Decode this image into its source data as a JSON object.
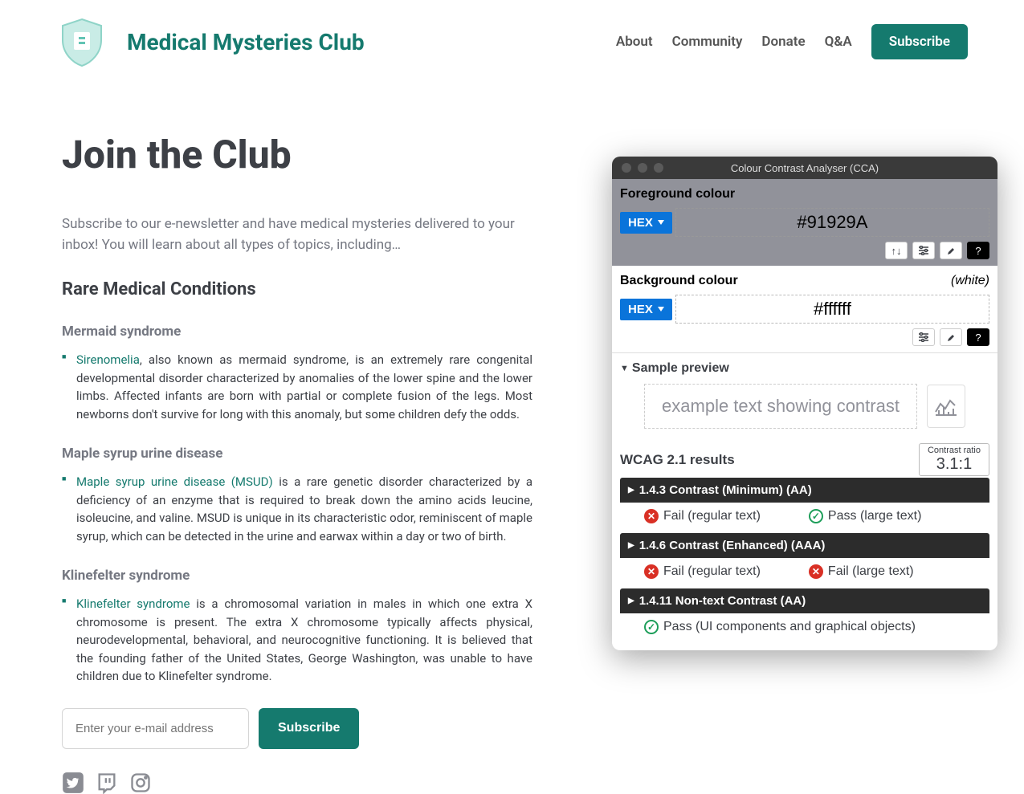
{
  "brand": {
    "title": "Medical Mysteries Club"
  },
  "nav": {
    "items": [
      "About",
      "Community",
      "Donate",
      "Q&A"
    ],
    "subscribe": "Subscribe"
  },
  "page": {
    "h1": "Join the Club",
    "intro": "Subscribe to our e-newsletter and have medical mysteries delivered to your inbox! You will learn about all types of topics, including…",
    "h2": "Rare Medical Conditions",
    "conditions": [
      {
        "title": "Mermaid syndrome",
        "link": "Sirenomelia",
        "text": ", also known as mermaid syndrome, is an extremely rare congenital developmental disorder characterized by anomalies of the lower spine and the lower limbs. Affected infants are born with partial or complete fusion of the legs. Most newborns don't survive for long with this anomaly, but some children defy the odds."
      },
      {
        "title": "Maple syrup urine disease",
        "link": "Maple syrup urine disease (MSUD)",
        "text": " is a rare genetic disorder characterized by a deficiency of an enzyme that is required to break down the amino acids leucine, isoleucine, and valine. MSUD is unique in its characteristic odor, reminiscent of maple syrup, which can be detected in the urine and earwax within a day or two of birth."
      },
      {
        "title": "Klinefelter syndrome",
        "link": "Klinefelter syndrome",
        "text": " is a chromosomal variation in males in which one extra X chromosome is present. The extra X chromosome typically affects physical, neurodevelopmental, behavioral, and neurocognitive functioning. It is believed that the founding father of the United States, George Washington, was unable to have children due to Klinefelter syndrome."
      }
    ],
    "email_placeholder": "Enter your e-mail address",
    "subscribe_btn": "Subscribe"
  },
  "cca": {
    "title": "Colour Contrast Analyser (CCA)",
    "fg": {
      "label": "Foreground colour",
      "format": "HEX",
      "value": "#91929A"
    },
    "bg": {
      "label": "Background colour",
      "note": "(white)",
      "format": "HEX",
      "value": "#ffffff"
    },
    "preview": {
      "header": "Sample preview",
      "text": "example text showing contrast"
    },
    "results": {
      "title": "WCAG 2.1 results",
      "ratio_label": "Contrast ratio",
      "ratio": "3.1:1",
      "criteria": [
        {
          "title": "1.4.3 Contrast (Minimum) (AA)",
          "items": [
            {
              "status": "fail",
              "text": "Fail (regular text)"
            },
            {
              "status": "pass",
              "text": "Pass (large text)"
            }
          ]
        },
        {
          "title": "1.4.6 Contrast (Enhanced) (AAA)",
          "items": [
            {
              "status": "fail",
              "text": "Fail (regular text)"
            },
            {
              "status": "fail",
              "text": "Fail (large text)"
            }
          ]
        },
        {
          "title": "1.4.11 Non-text Contrast (AA)",
          "items": [
            {
              "status": "pass",
              "text": "Pass (UI components and graphical objects)"
            }
          ]
        }
      ]
    }
  }
}
